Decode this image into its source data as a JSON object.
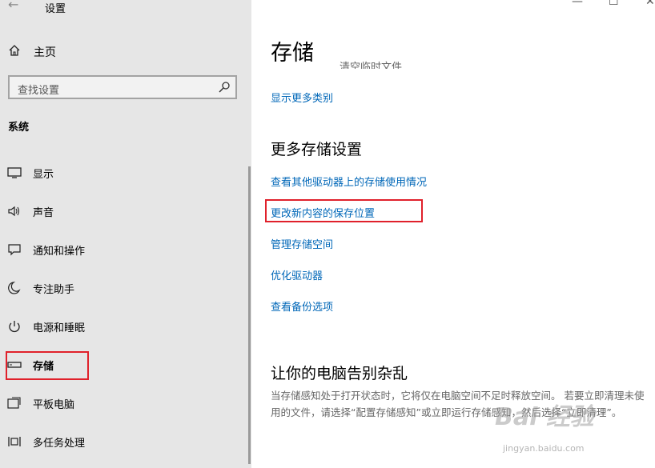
{
  "app": {
    "title": "设置",
    "back_glyph": "←"
  },
  "window_controls": {
    "minimize": "—",
    "maximize": "☐",
    "close": "✕"
  },
  "sidebar": {
    "home_label": "主页",
    "search_placeholder": "查找设置",
    "section_label": "系统",
    "items": [
      {
        "label": "显示",
        "icon": "display-icon"
      },
      {
        "label": "声音",
        "icon": "speaker-icon"
      },
      {
        "label": "通知和操作",
        "icon": "notification-icon"
      },
      {
        "label": "专注助手",
        "icon": "moon-icon"
      },
      {
        "label": "电源和睡眠",
        "icon": "power-icon"
      },
      {
        "label": "存储",
        "icon": "storage-icon",
        "active": true
      },
      {
        "label": "平板电脑",
        "icon": "tablet-icon"
      },
      {
        "label": "多任务处理",
        "icon": "multitask-icon"
      }
    ]
  },
  "main": {
    "title": "存储",
    "cut_off_text": "清空临时文件",
    "show_more_link": "显示更多类别",
    "more_settings_heading": "更多存储设置",
    "links": [
      "查看其他驱动器上的存储使用情况",
      "更改新内容的保存位置",
      "管理存储空间",
      "优化驱动器",
      "查看备份选项"
    ],
    "declutter_heading": "让你的电脑告别杂乱",
    "declutter_desc": "当存储感知处于打开状态时，它将仅在电脑空间不足时释放空间。 若要立即清理未使用的文件，请选择“配置存储感知”或立即运行存储感知，然后选择“立即清理”。"
  },
  "watermark": {
    "brand": "Bai 经验",
    "url": "jingyan.baidu.com"
  },
  "colors": {
    "sidebar_bg": "#e6e6e6",
    "link": "#0067b8",
    "highlight": "#e0212b"
  }
}
